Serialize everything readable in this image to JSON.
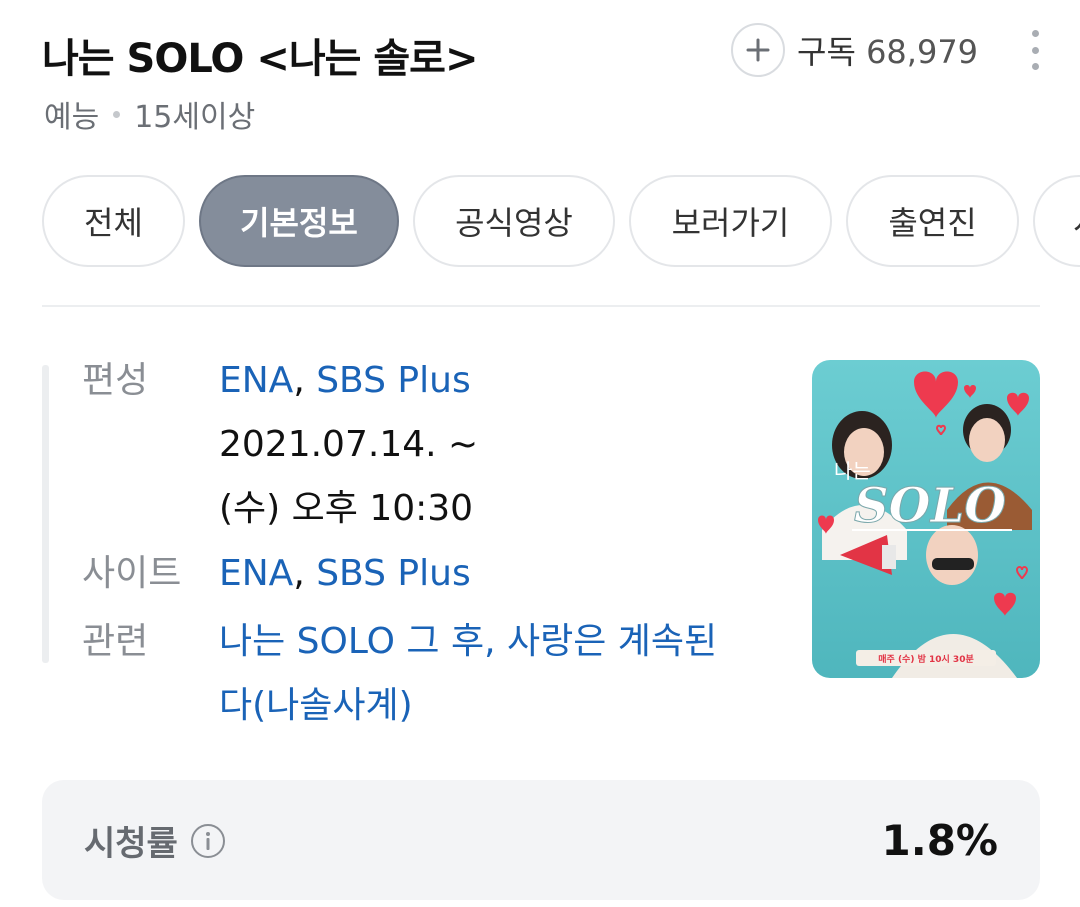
{
  "header": {
    "title": "나는 SOLO <나는 솔로>",
    "genre": "예능",
    "rating_age": "15세이상",
    "subscribe_label": "구독",
    "subscribe_count": "68,979"
  },
  "tabs": [
    {
      "label": "전체",
      "active": false
    },
    {
      "label": "기본정보",
      "active": true
    },
    {
      "label": "공식영상",
      "active": false
    },
    {
      "label": "보러가기",
      "active": false
    },
    {
      "label": "출연진",
      "active": false
    },
    {
      "label": "시",
      "active": false
    }
  ],
  "info": {
    "broadcast_label": "편성",
    "broadcast_channels": [
      "ENA",
      "SBS Plus"
    ],
    "broadcast_separator": ", ",
    "broadcast_date": "2021.07.14. ~",
    "broadcast_time": "(수) 오후 10:30",
    "site_label": "사이트",
    "site_channels": [
      "ENA",
      "SBS Plus"
    ],
    "related_label": "관련",
    "related_line1": "나는 SOLO 그 후, 사랑은 계속된",
    "related_line2": "다(나솔사계)"
  },
  "poster": {
    "title_small": "나는",
    "title_large": "SOLO",
    "schedule": "매주 (수) 밤 10시 30분",
    "colors": {
      "background": "#5cc2c8",
      "heart": "#ee3a4f"
    }
  },
  "viewer_rating": {
    "label": "시청률",
    "value": "1.8%"
  },
  "colors": {
    "link": "#1a63b7",
    "active_tab": "#848d9b",
    "label_gray": "#8a8e94"
  }
}
